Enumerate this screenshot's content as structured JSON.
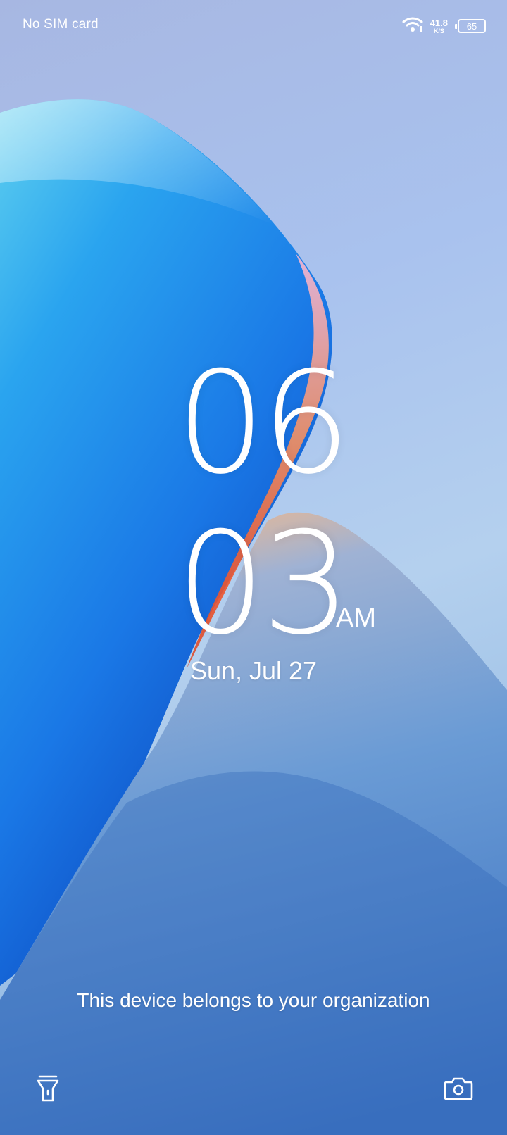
{
  "status_bar": {
    "carrier": "No SIM card",
    "net_speed_value": "41.8",
    "net_speed_unit": "K/S",
    "battery_level": "65",
    "icons": [
      "wifi-icon",
      "battery-icon"
    ]
  },
  "lock_screen": {
    "hour": "06",
    "minute": "03",
    "ampm": "AM",
    "date": "Sun, Jul 27",
    "org_notice": "This device belongs to your organization"
  },
  "shortcuts": {
    "left_icon": "flashlight-icon",
    "right_icon": "camera-icon"
  },
  "colors": {
    "text": "#ffffff",
    "sky": "#a9c2ee",
    "accent_blue": "#1e7fe0",
    "accent_orange": "#f0683a"
  }
}
